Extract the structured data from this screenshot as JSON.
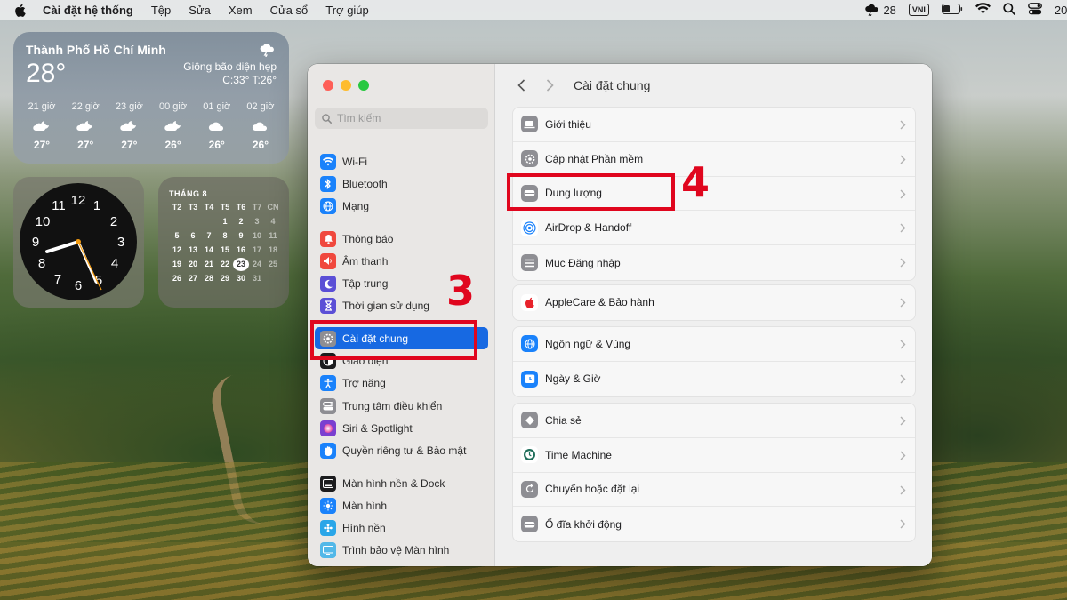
{
  "menubar": {
    "apple_icon": "apple-logo-icon",
    "app_name": "Cài đặt hệ thống",
    "menus": [
      "Tệp",
      "Sửa",
      "Xem",
      "Cửa sổ",
      "Trợ giúp"
    ],
    "weather_temp": "28",
    "input_method": "VNI",
    "clock_partial": "20:"
  },
  "weather_widget": {
    "city": "Thành Phố Hồ Chí Minh",
    "temperature": "28°",
    "condition": "Giông bão diện hẹp",
    "high_low": "C:33° T:26°",
    "forecast": [
      {
        "hour": "21 giờ",
        "temp": "27°",
        "icon": "cloud-moon-icon"
      },
      {
        "hour": "22 giờ",
        "temp": "27°",
        "icon": "cloud-moon-icon"
      },
      {
        "hour": "23 giờ",
        "temp": "27°",
        "icon": "cloud-moon-icon"
      },
      {
        "hour": "00 giờ",
        "temp": "26°",
        "icon": "cloud-moon-icon"
      },
      {
        "hour": "01 giờ",
        "temp": "26°",
        "icon": "cloud-icon"
      },
      {
        "hour": "02 giờ",
        "temp": "26°",
        "icon": "cloud-icon"
      }
    ]
  },
  "clock_widget": {
    "numbers": [
      "12",
      "1",
      "2",
      "3",
      "4",
      "5",
      "6",
      "7",
      "8",
      "9",
      "10",
      "11"
    ]
  },
  "calendar_widget": {
    "month": "THÁNG 8",
    "weekdays": [
      "T2",
      "T3",
      "T4",
      "T5",
      "T6",
      "T7",
      "CN"
    ],
    "today": "23"
  },
  "window": {
    "search_placeholder": "Tìm kiếm",
    "sidebar_groups": [
      [
        {
          "label": "Wi-Fi",
          "icon": "wifi-icon",
          "color": "#1a82fb"
        },
        {
          "label": "Bluetooth",
          "icon": "bluetooth-icon",
          "color": "#1a82fb"
        },
        {
          "label": "Mạng",
          "icon": "globe-network-icon",
          "color": "#1a82fb"
        }
      ],
      [
        {
          "label": "Thông báo",
          "icon": "bell-icon",
          "color": "#f0483d"
        },
        {
          "label": "Âm thanh",
          "icon": "speaker-icon",
          "color": "#f0483d"
        },
        {
          "label": "Tập trung",
          "icon": "moon-icon",
          "color": "#5b4fd6"
        },
        {
          "label": "Thời gian sử dụng",
          "icon": "hourglass-icon",
          "color": "#5b4fd6"
        }
      ],
      [
        {
          "label": "Cài đặt chung",
          "icon": "gear-icon",
          "color": "#8e8e93",
          "active": true
        },
        {
          "label": "Giao diện",
          "icon": "appearance-icon",
          "color": "#1c1c1e"
        },
        {
          "label": "Trợ năng",
          "icon": "accessibility-icon",
          "color": "#1a82fb"
        },
        {
          "label": "Trung tâm điều khiển",
          "icon": "control-center-icon",
          "color": "#8e8e93"
        },
        {
          "label": "Siri & Spotlight",
          "icon": "siri-icon",
          "color": "#7a3fd0"
        },
        {
          "label": "Quyền riêng tư & Bảo mật",
          "icon": "hand-icon",
          "color": "#1a82fb"
        }
      ],
      [
        {
          "label": "Màn hình nền & Dock",
          "icon": "dock-icon",
          "color": "#1c1c1e"
        },
        {
          "label": "Màn hình",
          "icon": "display-icon",
          "color": "#1a82fb"
        },
        {
          "label": "Hình nền",
          "icon": "wallpaper-icon",
          "color": "#2aa6e8"
        },
        {
          "label": "Trình bảo vệ Màn hình",
          "icon": "screensaver-icon",
          "color": "#52b8e8"
        }
      ]
    ],
    "main_title": "Cài đặt chung",
    "groups": [
      [
        {
          "label": "Giới thiệu",
          "icon": "laptop-icon",
          "color": "#8e8e93"
        },
        {
          "label": "Cập nhật Phần mềm",
          "icon": "gear-badge-icon",
          "color": "#8e8e93"
        },
        {
          "label": "Dung lượng",
          "icon": "drive-icon",
          "color": "#8e8e93"
        },
        {
          "label": "AirDrop & Handoff",
          "icon": "airdrop-icon",
          "color": "#ffffff"
        },
        {
          "label": "Mục Đăng nhập",
          "icon": "list-icon",
          "color": "#8e8e93"
        }
      ],
      [
        {
          "label": "AppleCare & Bảo hành",
          "icon": "apple-red-icon",
          "color": "#ffffff"
        }
      ],
      [
        {
          "label": "Ngôn ngữ & Vùng",
          "icon": "globe-icon",
          "color": "#1a82fb"
        },
        {
          "label": "Ngày & Giờ",
          "icon": "calendar-clock-icon",
          "color": "#1a82fb"
        }
      ],
      [
        {
          "label": "Chia sẻ",
          "icon": "sharing-icon",
          "color": "#8e8e93"
        },
        {
          "label": "Time Machine",
          "icon": "time-machine-icon",
          "color": "#ffffff"
        },
        {
          "label": "Chuyển hoặc đặt lại",
          "icon": "reset-icon",
          "color": "#8e8e93"
        },
        {
          "label": "Ổ đĩa khởi động",
          "icon": "startup-disk-icon",
          "color": "#8e8e93"
        }
      ]
    ]
  },
  "annotations": {
    "step_sidebar": "3",
    "step_storage": "4",
    "highlight_color": "#e0061e"
  }
}
